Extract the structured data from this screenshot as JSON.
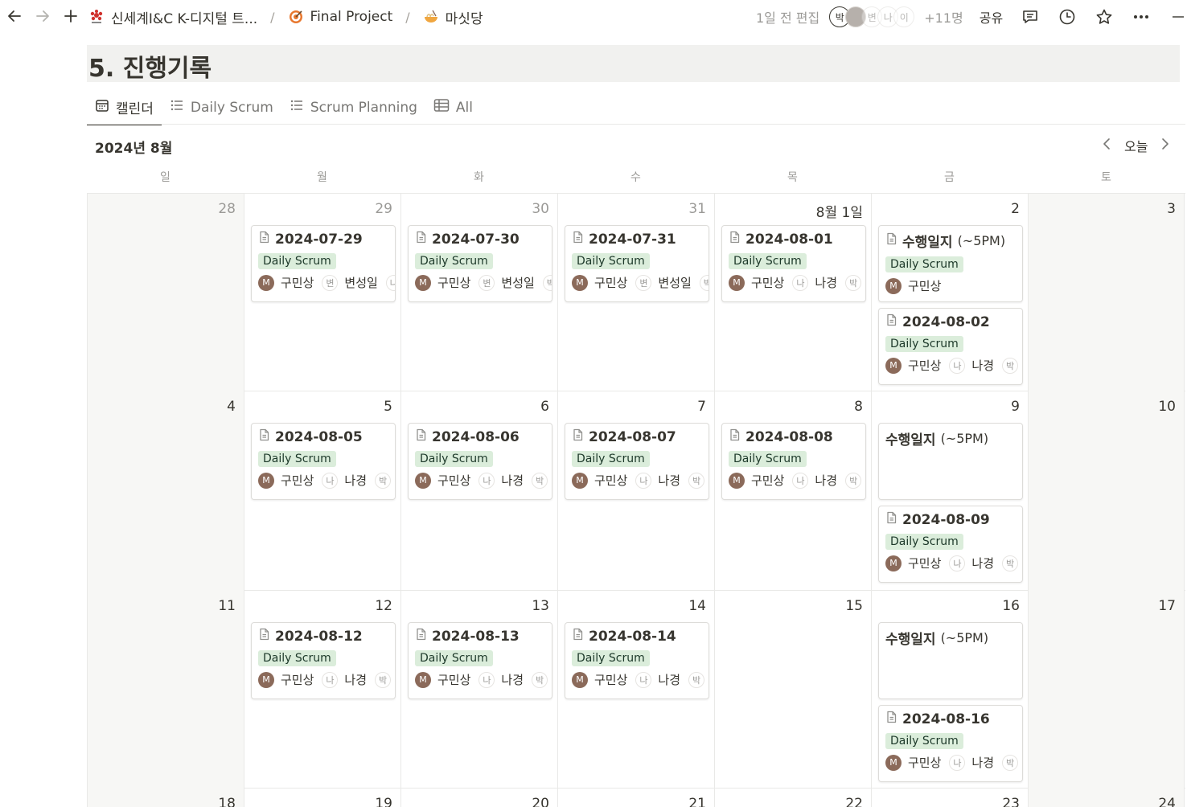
{
  "breadcrumbs": [
    {
      "label": "신세계I&C  K-디지털 트...",
      "icon": "company-logo-icon"
    },
    {
      "label": "Final Project",
      "icon": "target-icon"
    },
    {
      "label": "마싯당",
      "icon": "noodle-bowl-icon"
    }
  ],
  "topbar": {
    "edited": "1일 전 편집",
    "faces": [
      "박",
      "",
      "변",
      "나",
      "이"
    ],
    "more_people": "+11명",
    "share": "공유"
  },
  "page": {
    "title": "5. 진행기록"
  },
  "tabs": [
    {
      "label": "캘린더",
      "icon": "calendar-icon",
      "active": true
    },
    {
      "label": "Daily Scrum",
      "icon": "list-icon",
      "active": false
    },
    {
      "label": "Scrum Planning",
      "icon": "list-icon",
      "active": false
    },
    {
      "label": "All",
      "icon": "table-icon",
      "active": false
    }
  ],
  "calendar": {
    "month": "2024년 8월",
    "today": "오늘",
    "weekdays": [
      "일",
      "월",
      "화",
      "수",
      "목",
      "금",
      "토"
    ],
    "tag_color": "#dbeddb",
    "rows": [
      {
        "days": [
          {
            "num": "28",
            "out": true,
            "cards": []
          },
          {
            "num": "29",
            "out": true,
            "cards": [
              {
                "title": "2024-07-29",
                "doc": true,
                "tag": "Daily Scrum",
                "owner": "구민상",
                "p2": "변",
                "p2name": "변성일",
                "p3": "나"
              }
            ]
          },
          {
            "num": "30",
            "out": true,
            "cards": [
              {
                "title": "2024-07-30",
                "doc": true,
                "tag": "Daily Scrum",
                "owner": "구민상",
                "p2": "변",
                "p2name": "변성일",
                "p3": "박"
              }
            ]
          },
          {
            "num": "31",
            "out": true,
            "cards": [
              {
                "title": "2024-07-31",
                "doc": true,
                "tag": "Daily Scrum",
                "owner": "구민상",
                "p2": "변",
                "p2name": "변성일",
                "p3": "박"
              }
            ]
          },
          {
            "num": "8월 1일",
            "out": false,
            "cards": [
              {
                "title": "2024-08-01",
                "doc": true,
                "tag": "Daily Scrum",
                "owner": "구민상",
                "p2": "나",
                "p2name": "나경",
                "p3": "박"
              }
            ]
          },
          {
            "num": "2",
            "out": false,
            "cards": [
              {
                "title": "수행일지",
                "paren": "(~5PM)",
                "doc": true,
                "tag": "Daily Scrum",
                "owner": "구민상"
              },
              {
                "title": "2024-08-02",
                "doc": true,
                "tag": "Daily Scrum",
                "owner": "구민상",
                "p2": "나",
                "p2name": "나경",
                "p3": "박"
              }
            ]
          },
          {
            "num": "3",
            "out": false,
            "cards": []
          }
        ]
      },
      {
        "days": [
          {
            "num": "4",
            "out": false,
            "cards": []
          },
          {
            "num": "5",
            "out": false,
            "cards": [
              {
                "title": "2024-08-05",
                "doc": true,
                "tag": "Daily Scrum",
                "owner": "구민상",
                "p2": "나",
                "p2name": "나경",
                "p3": "박"
              }
            ]
          },
          {
            "num": "6",
            "out": false,
            "cards": [
              {
                "title": "2024-08-06",
                "doc": true,
                "tag": "Daily Scrum",
                "owner": "구민상",
                "p2": "나",
                "p2name": "나경",
                "p3": "박"
              }
            ]
          },
          {
            "num": "7",
            "out": false,
            "cards": [
              {
                "title": "2024-08-07",
                "doc": true,
                "tag": "Daily Scrum",
                "owner": "구민상",
                "p2": "나",
                "p2name": "나경",
                "p3": "박"
              }
            ]
          },
          {
            "num": "8",
            "out": false,
            "cards": [
              {
                "title": "2024-08-08",
                "doc": true,
                "tag": "Daily Scrum",
                "owner": "구민상",
                "p2": "나",
                "p2name": "나경",
                "p3": "박"
              }
            ]
          },
          {
            "num": "9",
            "out": false,
            "cards": [
              {
                "title": "수행일지",
                "paren": "(~5PM)",
                "doc": false
              },
              {
                "title": "2024-08-09",
                "doc": true,
                "tag": "Daily Scrum",
                "owner": "구민상",
                "p2": "나",
                "p2name": "나경",
                "p3": "박"
              }
            ]
          },
          {
            "num": "10",
            "out": false,
            "cards": []
          }
        ]
      },
      {
        "days": [
          {
            "num": "11",
            "out": false,
            "cards": []
          },
          {
            "num": "12",
            "out": false,
            "cards": [
              {
                "title": "2024-08-12",
                "doc": true,
                "tag": "Daily Scrum",
                "owner": "구민상",
                "p2": "나",
                "p2name": "나경",
                "p3": "박"
              }
            ]
          },
          {
            "num": "13",
            "out": false,
            "cards": [
              {
                "title": "2024-08-13",
                "doc": true,
                "tag": "Daily Scrum",
                "owner": "구민상",
                "p2": "나",
                "p2name": "나경",
                "p3": "박"
              }
            ]
          },
          {
            "num": "14",
            "out": false,
            "cards": [
              {
                "title": "2024-08-14",
                "doc": true,
                "tag": "Daily Scrum",
                "owner": "구민상",
                "p2": "나",
                "p2name": "나경",
                "p3": "박"
              }
            ]
          },
          {
            "num": "15",
            "out": false,
            "cards": []
          },
          {
            "num": "16",
            "out": false,
            "cards": [
              {
                "title": "수행일지",
                "paren": "(~5PM)",
                "doc": false
              },
              {
                "title": "2024-08-16",
                "doc": true,
                "tag": "Daily Scrum",
                "owner": "구민상",
                "p2": "나",
                "p2name": "나경",
                "p3": "박"
              }
            ]
          },
          {
            "num": "17",
            "out": false,
            "cards": []
          }
        ]
      },
      {
        "days": [
          {
            "num": "18",
            "out": false,
            "cards": []
          },
          {
            "num": "19",
            "out": false,
            "cards": []
          },
          {
            "num": "20",
            "out": false,
            "cards": []
          },
          {
            "num": "21",
            "out": false,
            "cards": []
          },
          {
            "num": "22",
            "out": false,
            "cards": []
          },
          {
            "num": "23",
            "out": false,
            "cards": []
          },
          {
            "num": "24",
            "out": false,
            "cards": []
          }
        ]
      }
    ]
  }
}
